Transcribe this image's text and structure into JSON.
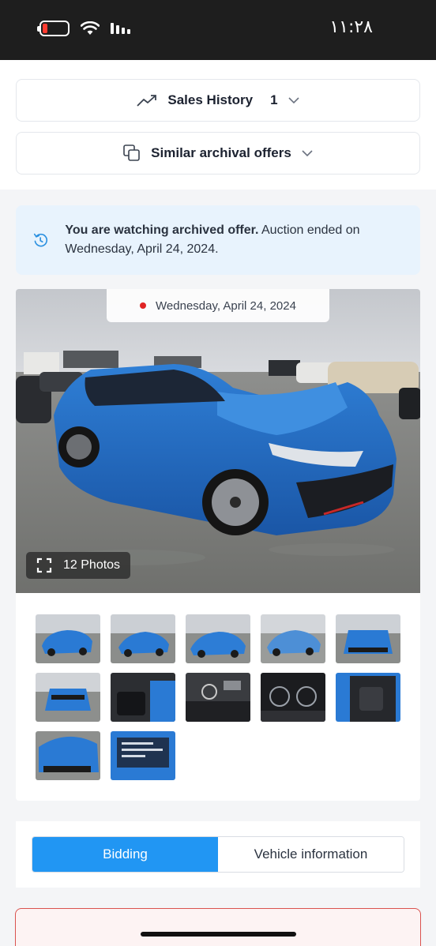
{
  "status_bar": {
    "time": "١١:٢٨",
    "battery_color": "#ff3b30"
  },
  "sales_history": {
    "label": "Sales History",
    "count": "1",
    "icon": "trending-up-icon"
  },
  "similar_offers": {
    "label": "Similar archival offers",
    "icon": "copy-icon"
  },
  "notice": {
    "bold_text": "You are watching archived offer.",
    "text": " Auction ended on Wednesday, April 24, 2024.",
    "icon": "history-icon",
    "background": "#e8f3fd"
  },
  "gallery": {
    "date": "Wednesday, April 24, 2024",
    "photos_label": "12 Photos",
    "thumbnail_count": 12
  },
  "tabs": {
    "bidding": "Bidding",
    "vehicle_information": "Vehicle information",
    "active_color": "#2196f3"
  }
}
